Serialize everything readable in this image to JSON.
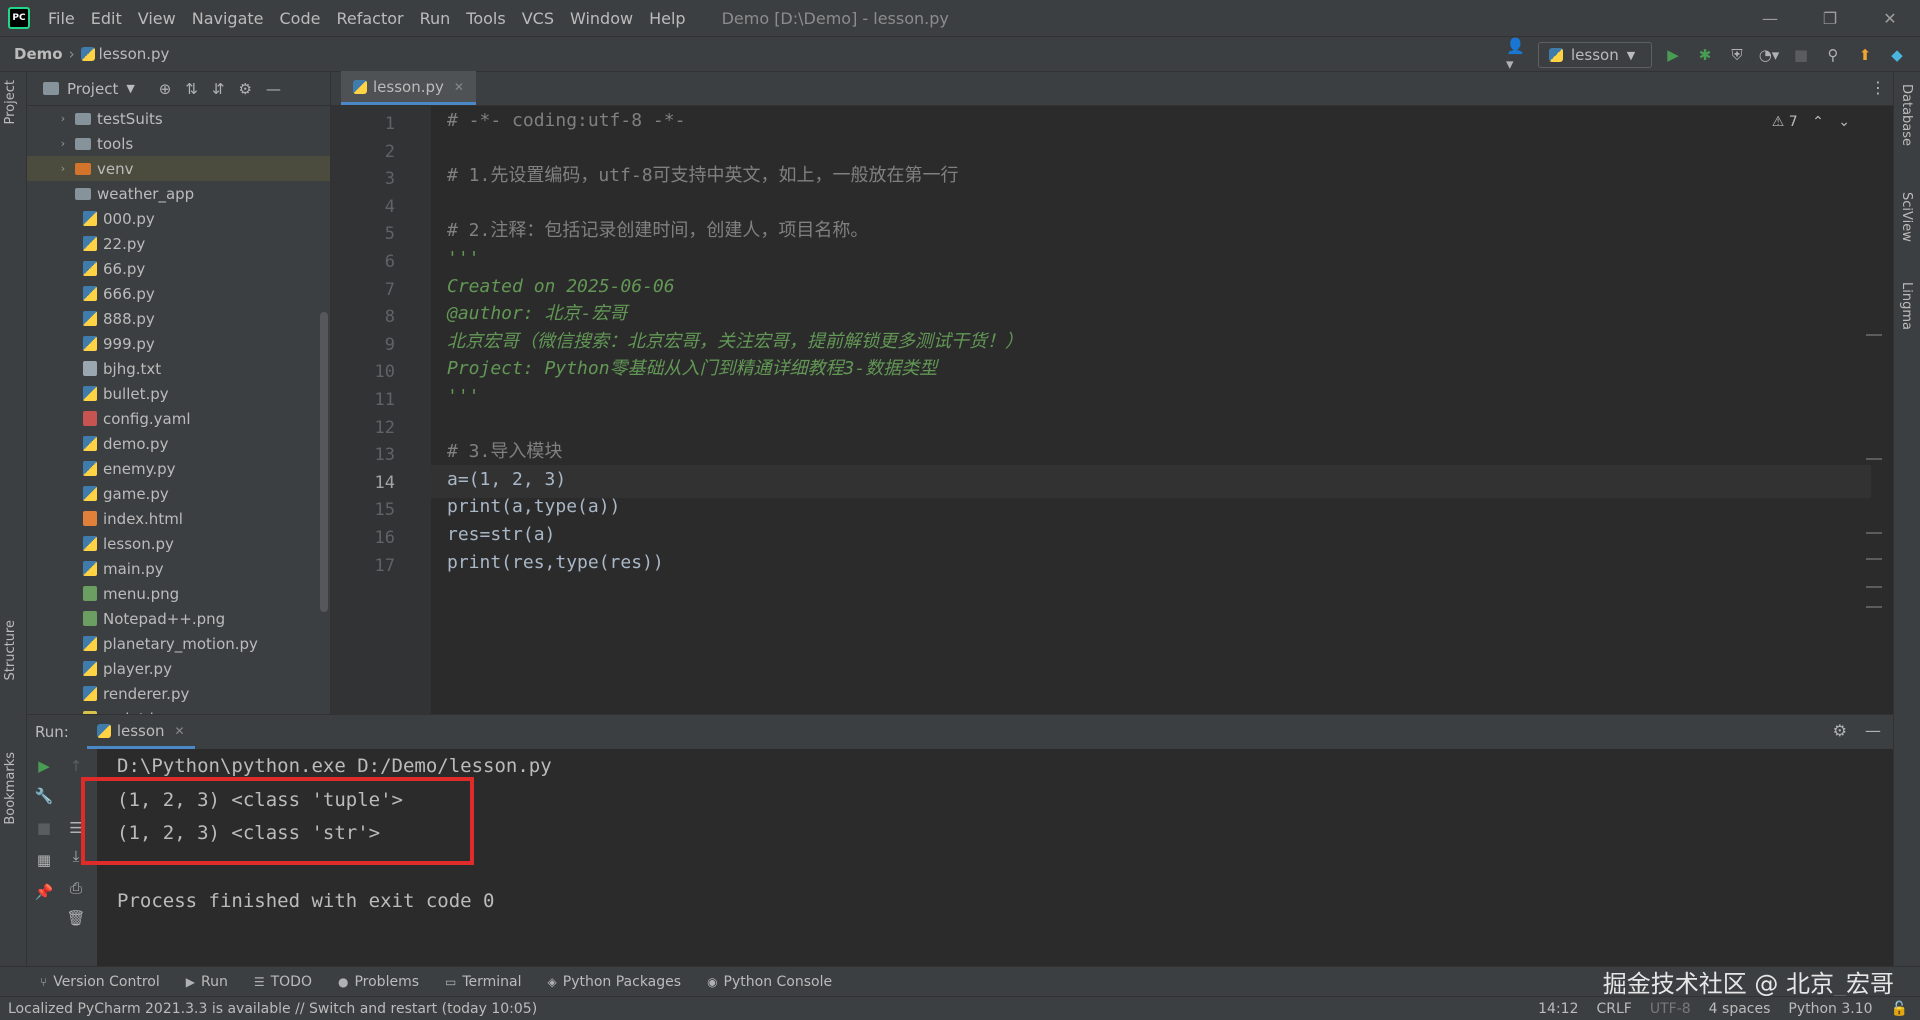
{
  "menubar": {
    "logo_text": "PC",
    "items": [
      "File",
      "Edit",
      "View",
      "Navigate",
      "Code",
      "Refactor",
      "Run",
      "Tools",
      "VCS",
      "Window",
      "Help"
    ],
    "window_title": "Demo [D:\\Demo] - lesson.py"
  },
  "navbar": {
    "root": "Demo",
    "file": "lesson.py",
    "run_config": "lesson"
  },
  "left_stripe": {
    "project": "Project",
    "structure": "Structure",
    "bookmarks": "Bookmarks"
  },
  "right_stripe": {
    "database": "Database",
    "sciview": "SciView",
    "lingma": "Lingma"
  },
  "project": {
    "title": "Project",
    "tree": [
      {
        "name": "testSuits",
        "kind": "folder",
        "expandable": true
      },
      {
        "name": "tools",
        "kind": "folder",
        "expandable": true
      },
      {
        "name": "venv",
        "kind": "folder-orange",
        "expandable": true,
        "selected": true
      },
      {
        "name": "weather_app",
        "kind": "folder",
        "expandable": false
      },
      {
        "name": "000.py",
        "kind": "py"
      },
      {
        "name": "22.py",
        "kind": "py"
      },
      {
        "name": "66.py",
        "kind": "py"
      },
      {
        "name": "666.py",
        "kind": "py"
      },
      {
        "name": "888.py",
        "kind": "py"
      },
      {
        "name": "999.py",
        "kind": "py"
      },
      {
        "name": "bjhg.txt",
        "kind": "txt"
      },
      {
        "name": "bullet.py",
        "kind": "py"
      },
      {
        "name": "config.yaml",
        "kind": "yaml"
      },
      {
        "name": "demo.py",
        "kind": "py"
      },
      {
        "name": "enemy.py",
        "kind": "py"
      },
      {
        "name": "game.py",
        "kind": "py"
      },
      {
        "name": "index.html",
        "kind": "html"
      },
      {
        "name": "lesson.py",
        "kind": "py"
      },
      {
        "name": "main.py",
        "kind": "py"
      },
      {
        "name": "menu.png",
        "kind": "png"
      },
      {
        "name": "Notepad++.png",
        "kind": "png"
      },
      {
        "name": "planetary_motion.py",
        "kind": "py"
      },
      {
        "name": "player.py",
        "kind": "py"
      },
      {
        "name": "renderer.py",
        "kind": "py"
      },
      {
        "name": "script.js",
        "kind": "js"
      }
    ]
  },
  "editor": {
    "tab": "lesson.py",
    "inspections": "7",
    "current_line": 14,
    "lines": [
      {
        "n": "1",
        "text": "# -*- coding:utf-8 -*-",
        "cls": "c-comment"
      },
      {
        "n": "2",
        "text": "",
        "cls": "c-plain"
      },
      {
        "n": "3",
        "text": "# 1.先设置编码，utf-8可支持中英文，如上，一般放在第一行",
        "cls": "c-comment"
      },
      {
        "n": "4",
        "text": "",
        "cls": "c-plain"
      },
      {
        "n": "5",
        "text": "# 2.注释：包括记录创建时间，创建人，项目名称。",
        "cls": "c-comment"
      },
      {
        "n": "6",
        "text": "'''",
        "cls": "c-doc"
      },
      {
        "n": "7",
        "text": "Created on 2025-06-06",
        "cls": "c-doc"
      },
      {
        "n": "8",
        "text": "@author: 北京-宏哥",
        "cls": "c-doc"
      },
      {
        "n": "9",
        "text": "北京宏哥（微信搜索：北京宏哥，关注宏哥，提前解锁更多测试干货！）",
        "cls": "c-doc"
      },
      {
        "n": "10",
        "text": "Project: Python零基础从入门到精通详细教程3-数据类型",
        "cls": "c-doc"
      },
      {
        "n": "11",
        "text": "'''",
        "cls": "c-doc"
      },
      {
        "n": "12",
        "text": "",
        "cls": "c-plain"
      },
      {
        "n": "13",
        "text": "# 3.导入模块",
        "cls": "c-comment"
      },
      {
        "n": "14",
        "text": "a=(1, 2, 3)",
        "cls": "c-plain"
      },
      {
        "n": "15",
        "text": "print(a,type(a))",
        "cls": "c-plain"
      },
      {
        "n": "16",
        "text": "res=str(a)",
        "cls": "c-plain"
      },
      {
        "n": "17",
        "text": "print(res,type(res))",
        "cls": "c-plain"
      }
    ]
  },
  "run": {
    "label": "Run:",
    "tab": "lesson",
    "console": [
      "D:\\Python\\python.exe D:/Demo/lesson.py",
      "(1, 2, 3) <class 'tuple'>",
      "(1, 2, 3) <class 'str'>",
      "",
      "Process finished with exit code 0"
    ]
  },
  "tool_tabs": [
    "Version Control",
    "Run",
    "TODO",
    "Problems",
    "Terminal",
    "Python Packages",
    "Python Console"
  ],
  "watermark": "掘金技术社区 @ 北京_宏哥",
  "status": {
    "message": "Localized PyCharm 2021.3.3 is available // Switch and restart (today 10:05)",
    "position": "14:12",
    "line_sep": "CRLF",
    "encoding": "UTF-8",
    "indent": "4 spaces",
    "interpreter": "Python 3.10"
  },
  "colors": {
    "accent": "#4a88c7",
    "highlight_box": "#e02b2b",
    "run_green": "#499c54"
  }
}
